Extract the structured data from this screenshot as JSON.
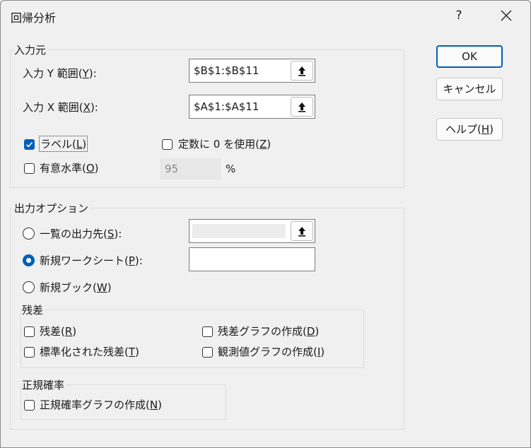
{
  "window": {
    "title": "回帰分析",
    "help_glyph": "?"
  },
  "input_group": {
    "label": "入力元",
    "y_range": {
      "label_prefix": "入力 Y 範囲(",
      "mnemonic": "Y",
      "label_suffix": "):",
      "value": "$B$1:$B$11"
    },
    "x_range": {
      "label_prefix": "入力 X 範囲(",
      "mnemonic": "X",
      "label_suffix": "):",
      "value": "$A$1:$A$11"
    },
    "labels": {
      "prefix": "ラベル(",
      "mnemonic": "L",
      "suffix": ")",
      "checked": true
    },
    "constant_zero": {
      "prefix": "定数に 0 を使用(",
      "mnemonic": "Z",
      "suffix": ")",
      "checked": false
    },
    "confidence": {
      "prefix": "有意水準(",
      "mnemonic": "O",
      "suffix": ")",
      "checked": false,
      "value": "95",
      "unit": "%"
    }
  },
  "output_group": {
    "label": "出力オプション",
    "output_range": {
      "prefix": "一覧の出力先(",
      "mnemonic": "S",
      "suffix": "):",
      "selected": false,
      "value": ""
    },
    "new_worksheet": {
      "prefix": "新規ワークシート(",
      "mnemonic": "P",
      "suffix": "):",
      "selected": true,
      "value": ""
    },
    "new_workbook": {
      "prefix": "新規ブック(",
      "mnemonic": "W",
      "suffix": ")",
      "selected": false
    }
  },
  "residuals_group": {
    "label": "残差",
    "residuals": {
      "prefix": "残差(",
      "mnemonic": "R",
      "suffix": ")",
      "checked": false
    },
    "standardized": {
      "prefix": "標準化された残差(",
      "mnemonic": "T",
      "suffix": ")",
      "checked": false
    },
    "residual_plots": {
      "prefix": "残差グラフの作成(",
      "mnemonic": "D",
      "suffix": ")",
      "checked": false
    },
    "line_fit_plots": {
      "prefix": "観測値グラフの作成(",
      "mnemonic": "I",
      "suffix": ")",
      "checked": false
    }
  },
  "normal_group": {
    "label": "正規確率",
    "normal_plots": {
      "prefix": "正規確率グラフの作成(",
      "mnemonic": "N",
      "suffix": ")",
      "checked": false
    }
  },
  "buttons": {
    "ok": "OK",
    "cancel": "キャンセル",
    "help": {
      "prefix": "ヘルプ(",
      "mnemonic": "H",
      "suffix": ")"
    }
  },
  "colors": {
    "accent": "#005fb8",
    "background": "#f0f0f0"
  },
  "icons": {
    "close": "close-icon",
    "range_picker": "collapse-arrow-icon",
    "check": "check-icon"
  }
}
